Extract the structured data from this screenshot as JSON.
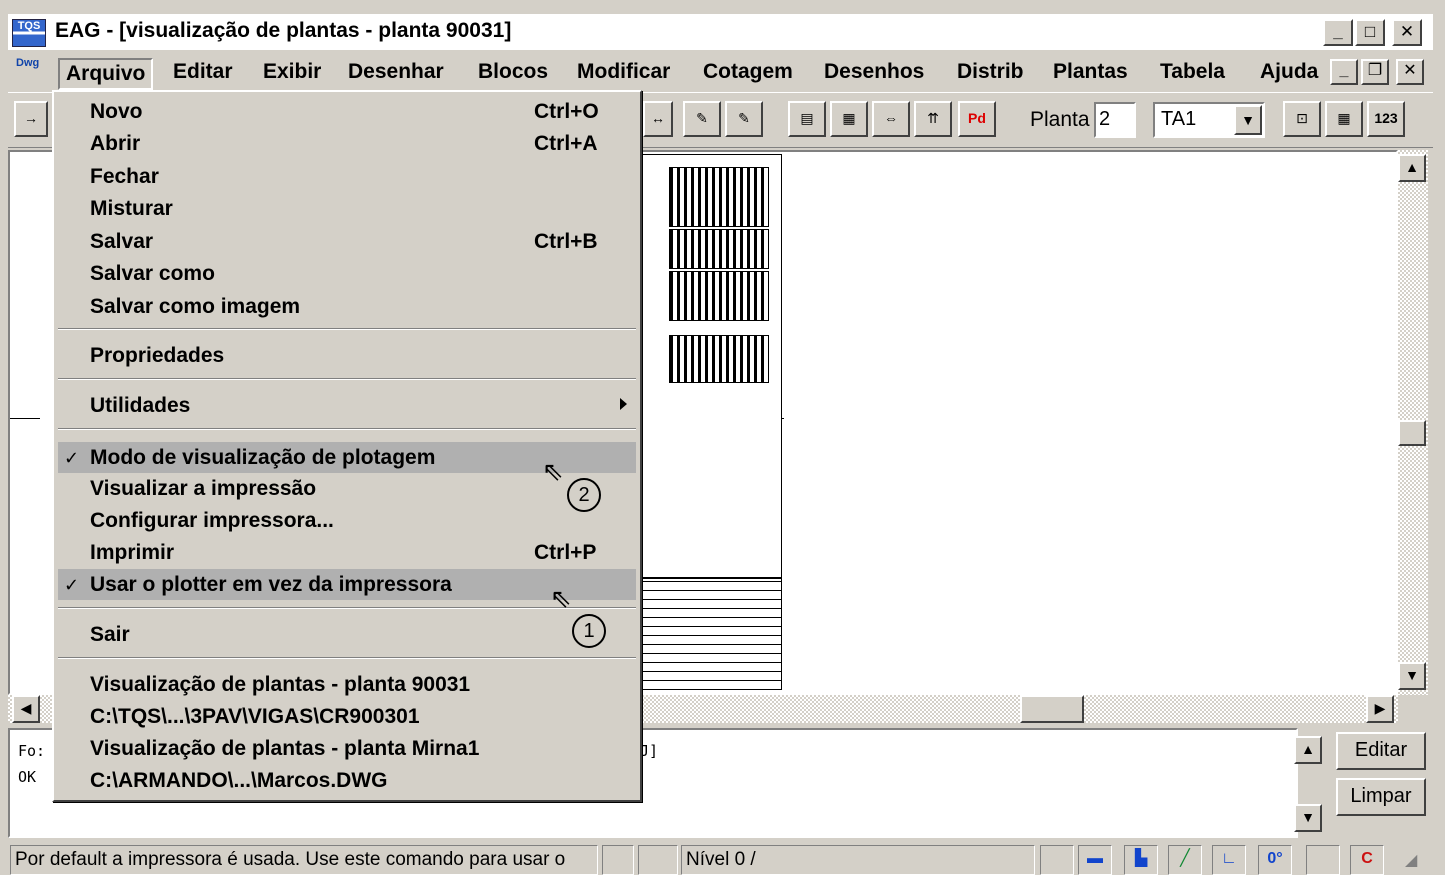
{
  "window": {
    "title": "EAG - [visualização de plantas - planta 90031]"
  },
  "menubar": [
    "Arquivo",
    "Editar",
    "Exibir",
    "Desenhar",
    "Blocos",
    "Modificar",
    "Cotagem",
    "Desenhos",
    "Distrib",
    "Plantas",
    "Tabela",
    "Ajuda"
  ],
  "toolbar": {
    "planta_label": "Planta",
    "planta_value": "2",
    "sheet_value": "TA1"
  },
  "menu": {
    "items": [
      {
        "label": "Novo",
        "shortcut": "Ctrl+O"
      },
      {
        "label": "Abrir",
        "shortcut": "Ctrl+A"
      },
      {
        "label": "Fechar",
        "shortcut": ""
      },
      {
        "label": "Misturar",
        "shortcut": ""
      },
      {
        "label": "Salvar",
        "shortcut": "Ctrl+B"
      },
      {
        "label": "Salvar como",
        "shortcut": ""
      },
      {
        "label": "Salvar como imagem",
        "shortcut": ""
      },
      {
        "label": "Propriedades",
        "shortcut": ""
      },
      {
        "label": "Utilidades",
        "shortcut": ""
      },
      {
        "label": "Modo de visualização de plotagem",
        "shortcut": "",
        "checked": true
      },
      {
        "label": "Visualizar a impressão",
        "shortcut": ""
      },
      {
        "label": "Configurar impressora...",
        "shortcut": ""
      },
      {
        "label": "Imprimir",
        "shortcut": "Ctrl+P"
      },
      {
        "label": "Usar o plotter em vez da impressora",
        "shortcut": "",
        "checked": true
      },
      {
        "label": "Sair",
        "shortcut": ""
      },
      {
        "label": "Visualização de plantas - planta 90031",
        "shortcut": ""
      },
      {
        "label": "C:\\TQS\\...\\3PAV\\VIGAS\\CR900301",
        "shortcut": ""
      },
      {
        "label": "Visualização de plantas - planta Mirna1",
        "shortcut": ""
      },
      {
        "label": "C:\\ARMANDO\\...\\Marcos.DWG",
        "shortcut": ""
      }
    ],
    "check_glyph": "✓"
  },
  "callouts": {
    "first": "1",
    "second": "2"
  },
  "command": {
    "line1": "Fo:",
    "line2": "OK",
    "line1_tail": "J]"
  },
  "side_buttons": {
    "editar": "Editar",
    "limpar": "Limpar"
  },
  "status": {
    "hint": "Por default a impressora é usada. Use este comando para usar o",
    "level": "Nível 0 /"
  }
}
